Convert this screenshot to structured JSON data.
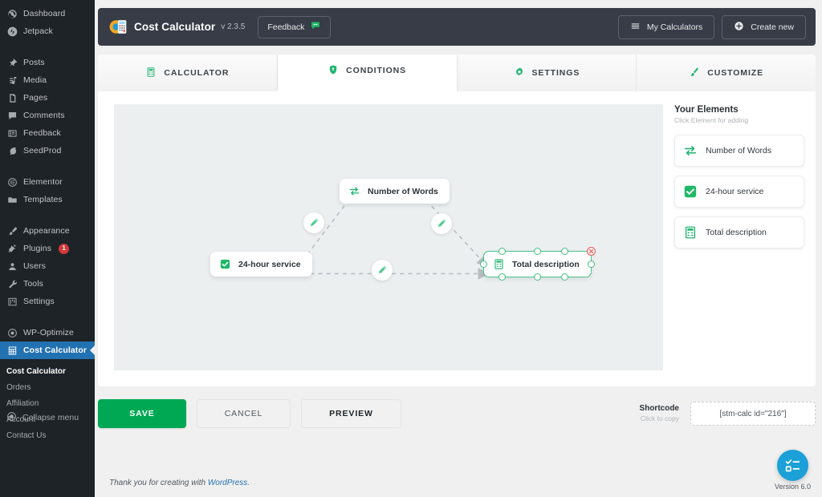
{
  "wp_sidebar": {
    "groups": [
      {
        "items": [
          {
            "label": "Dashboard",
            "icon": "dashboard-icon"
          },
          {
            "label": "Jetpack",
            "icon": "jetpack-icon"
          }
        ]
      },
      {
        "items": [
          {
            "label": "Posts",
            "icon": "pin-icon"
          },
          {
            "label": "Media",
            "icon": "media-icon"
          },
          {
            "label": "Pages",
            "icon": "pages-icon"
          },
          {
            "label": "Comments",
            "icon": "comments-icon"
          },
          {
            "label": "Feedback",
            "icon": "feedback-icon"
          },
          {
            "label": "SeedProd",
            "icon": "seedprod-icon"
          }
        ]
      },
      {
        "items": [
          {
            "label": "Elementor",
            "icon": "elementor-icon"
          },
          {
            "label": "Templates",
            "icon": "templates-icon"
          }
        ]
      },
      {
        "items": [
          {
            "label": "Appearance",
            "icon": "brush-icon"
          },
          {
            "label": "Plugins",
            "icon": "plugins-icon",
            "badge": "1"
          },
          {
            "label": "Users",
            "icon": "users-icon"
          },
          {
            "label": "Tools",
            "icon": "wrench-icon"
          },
          {
            "label": "Settings",
            "icon": "settings-icon"
          }
        ]
      },
      {
        "items": [
          {
            "label": "WP-Optimize",
            "icon": "optimize-icon"
          },
          {
            "label": "Cost Calculator",
            "icon": "calculator-icon",
            "active": true
          }
        ]
      }
    ],
    "submenu": [
      {
        "label": "Cost Calculator",
        "current": true
      },
      {
        "label": "Orders"
      },
      {
        "label": "Affiliation"
      },
      {
        "label": "Account"
      },
      {
        "label": "Contact Us"
      }
    ],
    "collapse_label": "Collapse menu"
  },
  "header": {
    "title": "Cost Calculator",
    "version": "v 2.3.5",
    "feedback_label": "Feedback",
    "my_calculators_label": "My Calculators",
    "create_new_label": "Create new"
  },
  "tabs": [
    {
      "label": "CALCULATOR",
      "icon": "calculator-icon",
      "active": false
    },
    {
      "label": "CONDITIONS",
      "icon": "shield-icon",
      "active": true
    },
    {
      "label": "SETTINGS",
      "icon": "gear-icon",
      "active": false
    },
    {
      "label": "CUSTOMIZE",
      "icon": "brush-icon",
      "active": false
    }
  ],
  "elements_panel": {
    "title": "Your Elements",
    "subtitle": "Click Element for adding",
    "items": [
      {
        "label": "Number of Words",
        "icon": "swap-arrows-icon"
      },
      {
        "label": "24-hour service",
        "icon": "checkbox-icon"
      },
      {
        "label": "Total description",
        "icon": "calculator-icon"
      }
    ]
  },
  "flow": {
    "nodes": [
      {
        "id": "number_of_words",
        "label": "Number of Words",
        "icon": "swap-arrows-icon",
        "selected": false
      },
      {
        "id": "service_24h",
        "label": "24-hour service",
        "icon": "checkbox-icon",
        "selected": false
      },
      {
        "id": "total_description",
        "label": "Total description",
        "icon": "calculator-icon",
        "selected": true
      }
    ],
    "edge_icon": "pencil-icon",
    "delete_icon": "close-icon"
  },
  "actions": {
    "save_label": "SAVE",
    "cancel_label": "CANCEL",
    "preview_label": "PREVIEW"
  },
  "shortcode": {
    "title": "Shortcode",
    "subtitle": "Click to copy",
    "value": "[stm-calc id=\"216\"]"
  },
  "footer": {
    "text_before": "Thank you for creating with ",
    "link": "WordPress",
    "text_after": "."
  },
  "version_badge": {
    "label": "Version 6.0",
    "icon": "checklist-icon"
  },
  "colors": {
    "accent_green": "#00a854",
    "node_green": "#3fc07e",
    "wp_blue": "#2271b1",
    "badge_blue": "#1ba0d7",
    "header_dark": "#373c46",
    "sidebar_dark": "#1d2327",
    "delete_red": "#e35d5d"
  }
}
